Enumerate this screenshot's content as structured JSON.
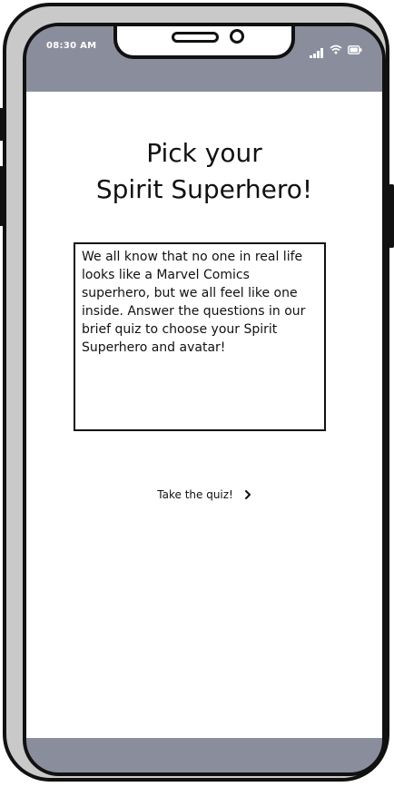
{
  "status_bar": {
    "time": "08:30 AM",
    "icons": [
      "signal-icon",
      "wifi-icon",
      "battery-icon"
    ]
  },
  "main": {
    "title_line1": "Pick your",
    "title_line2": "Spirit Superhero!",
    "intro": "We all know that no one in real life looks like a Marvel Comics superhero, but we all feel like one inside. Answer the questions in our brief quiz to choose your Spirit Superhero and avatar!",
    "cta_label": "Take the quiz!",
    "cta_icon": "chevron-right-icon"
  },
  "colors": {
    "chrome": "#8a8e9c",
    "frame": "#c9c9c9",
    "outline": "#111111"
  }
}
